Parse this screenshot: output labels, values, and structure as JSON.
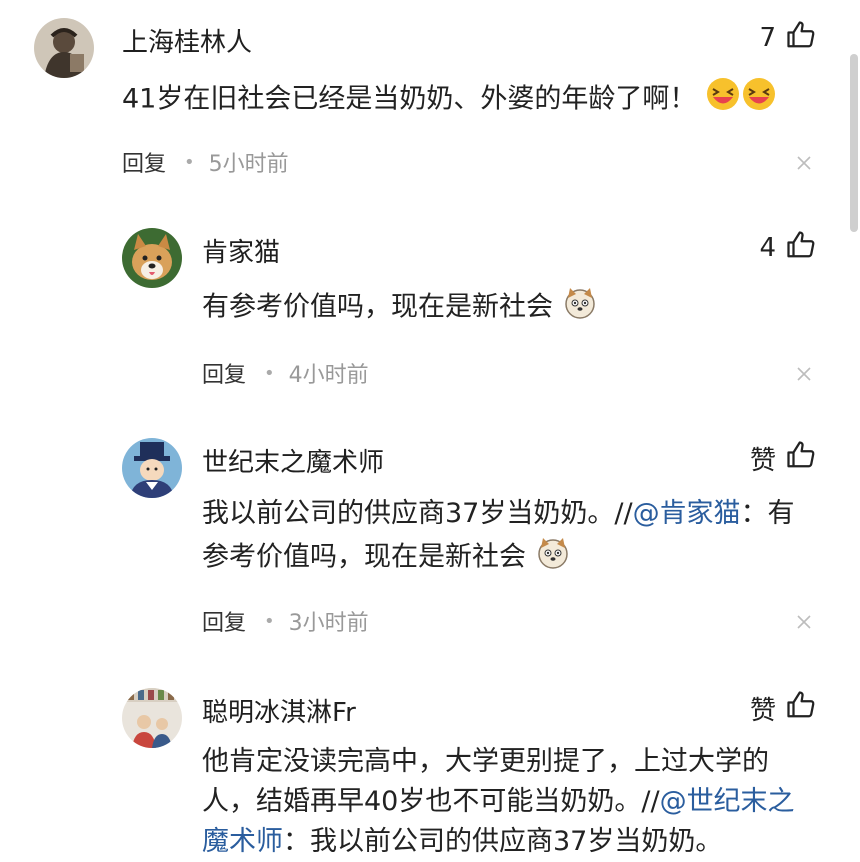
{
  "comments": [
    {
      "user": "上海桂林人",
      "likes": "7",
      "text": "41岁在旧社会已经是当奶奶、外婆的年龄了啊！",
      "emojis": [
        "laugh-emoji",
        "laugh-emoji"
      ],
      "reply_label": "回复",
      "time": "5小时前"
    },
    {
      "user": "肯家猫",
      "likes": "4",
      "text": "有参考价值吗，现在是新社会",
      "emojis": [
        "dog-emoji"
      ],
      "reply_label": "回复",
      "time": "4小时前"
    },
    {
      "user": "世纪末之魔术师",
      "likes": "赞",
      "text_line1_main": "我以前公司的供应商37岁当奶奶。//",
      "text_line1_mention": "@肯家猫",
      "text_line1_tail": "：有",
      "text_line2": "参考价值吗，现在是新社会",
      "emojis": [
        "dog-emoji"
      ],
      "reply_label": "回复",
      "time": "3小时前"
    },
    {
      "user": "聪明冰淇淋Fr",
      "likes": "赞",
      "text_line1": "他肯定没读完高中，大学更别提了，上过大学的",
      "text_line2_main": "人，结婚再早40岁也不可能当奶奶。//",
      "text_line2_mention": "@世纪末之",
      "text_line3_mention": "魔术师",
      "text_line3_tail": "：我以前公司的供应商37岁当奶奶。"
    }
  ],
  "colors": {
    "mention": "#2a5d9e",
    "meta_time": "#999999",
    "scrollbar": "#cfcfcf"
  }
}
